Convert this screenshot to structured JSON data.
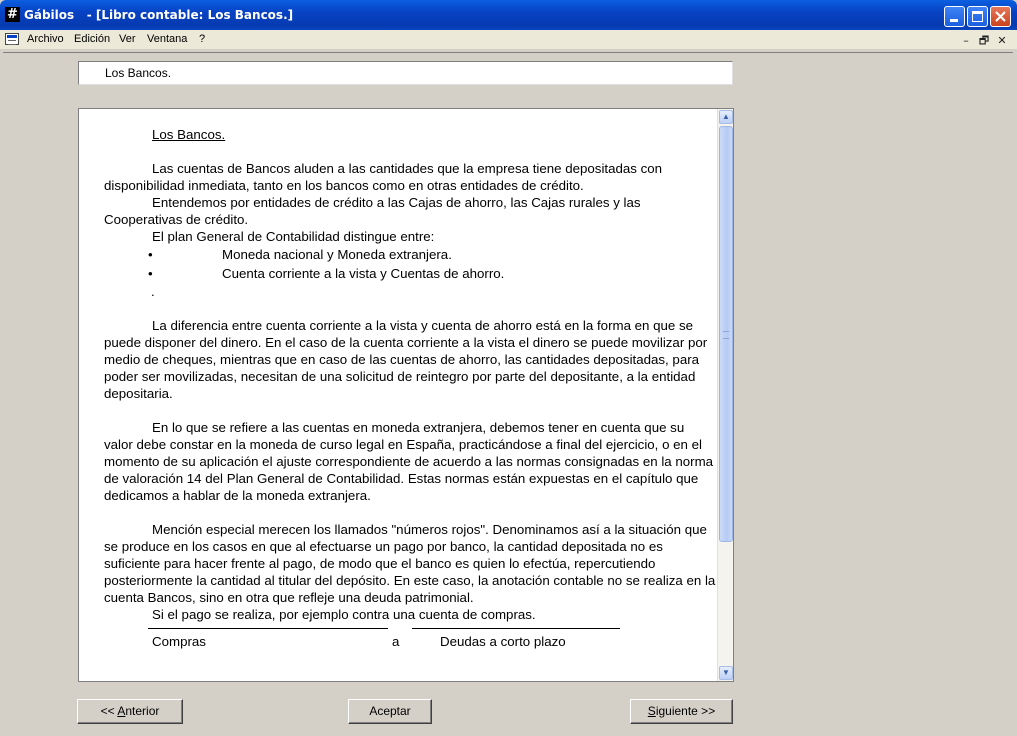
{
  "window": {
    "app_name": "Gábilos",
    "document_title": "   - [Libro contable: Los Bancos.]",
    "app_icon": "#"
  },
  "menu": [
    "Archivo",
    "Edición",
    "Ver",
    "Ventana",
    "?"
  ],
  "mdi_controls": {
    "minimize": "–",
    "restore": "🗗",
    "close": "✕"
  },
  "heading_field": {
    "value": "Los Bancos."
  },
  "content": {
    "title": "Los Bancos.",
    "p1": "Las cuentas de Bancos aluden a las cantidades que la empresa tiene depositadas con disponibilidad inmediata, tanto en los bancos como en otras entidades de crédito.",
    "p2": "Entendemos por entidades de crédito a las Cajas de ahorro, las Cajas rurales y las Cooperativas de crédito.",
    "p3": "El plan General de Contabilidad distingue entre:",
    "bullets": [
      "Moneda nacional y Moneda extranjera.",
      "Cuenta corriente a la vista y Cuentas de ahorro."
    ],
    "dot": ".",
    "p4": "La diferencia entre cuenta corriente a la vista y cuenta de ahorro está en la forma en que se puede disponer del dinero. En el caso de la cuenta corriente a la vista el dinero se puede movilizar por medio de cheques, mientras que en caso de las cuentas de ahorro, las cantidades depositadas, para poder ser movilizadas, necesitan de una solicitud de reintegro por parte del depositante, a la entidad depositaria.",
    "p5": "En lo que se refiere a las cuentas en moneda extranjera, debemos tener en cuenta que su valor debe constar en la moneda de curso legal en España, practicándose a final del ejercicio, o en el momento de su aplicación el ajuste correspondiente de acuerdo a las normas consignadas en la norma de valoración 14 del Plan General de Contabilidad. Estas normas están expuestas en el capítulo que dedicamos a hablar de la moneda extranjera.",
    "p6": "Mención especial merecen los llamados \"números rojos\". Denominamos así a la situación que se produce en los casos en que al efectuarse un pago por banco, la cantidad depositada no es suficiente para hacer frente al pago, de modo que el banco es quien lo efectúa, repercutiendo posteriormente la cantidad al titular del depósito. En este caso, la anotación contable no se realiza en la cuenta Bancos, sino en otra que refleje una deuda patrimonial.",
    "p7": "Si el pago se realiza, por ejemplo contra una cuenta de compras.",
    "ledger": {
      "debit": "Compras",
      "connector": "a",
      "credit": "Deudas a corto plazo"
    }
  },
  "buttons": {
    "prev_prefix": "<< ",
    "prev_accel": "A",
    "prev_rest": "nterior",
    "ok": "Aceptar",
    "next_accel": "S",
    "next_rest": "iguiente >>"
  }
}
